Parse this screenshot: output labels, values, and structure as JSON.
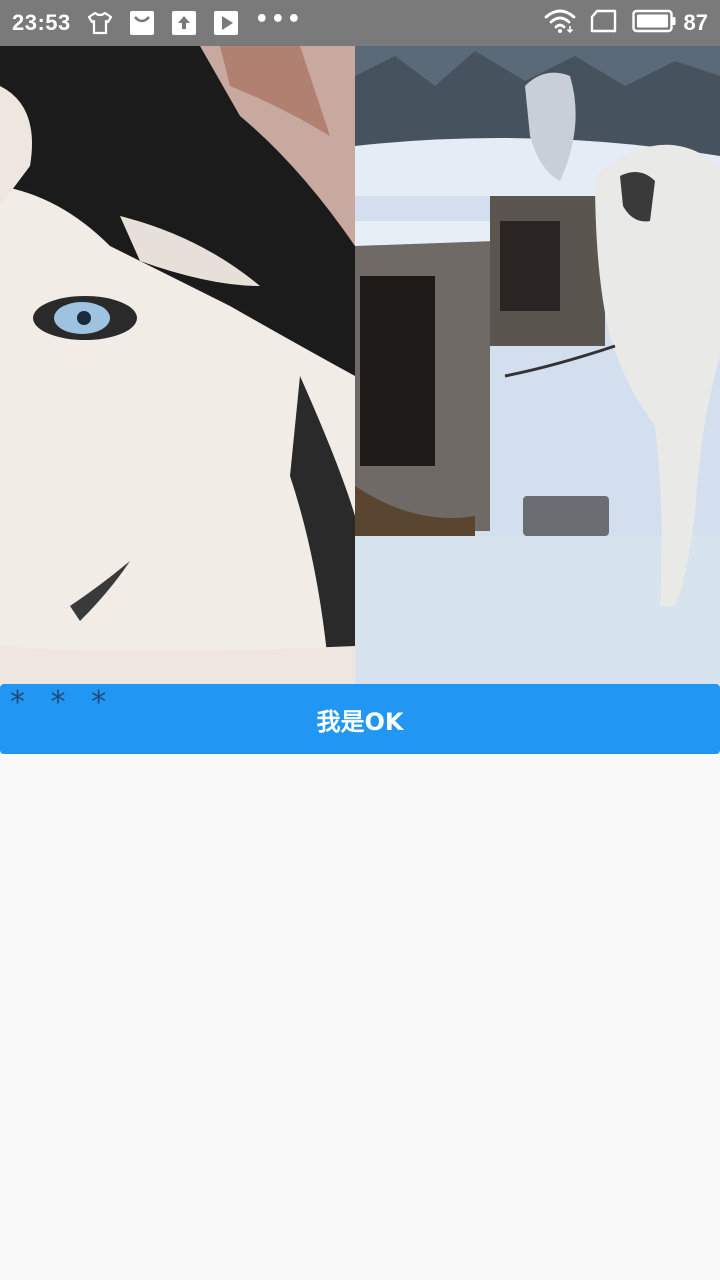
{
  "status_bar": {
    "time": "23:53",
    "left_icons": [
      "tshirt-icon",
      "shopping-bag-icon",
      "upload-icon",
      "play-icon"
    ],
    "more_dots": "•••",
    "battery_level": "87",
    "background_color": "#7a7a7a"
  },
  "images": {
    "left": "husky-closeup-photo",
    "right": "husky-snow-photo"
  },
  "button": {
    "label": "我是OK",
    "stars": "* * *",
    "color": "#2196f3"
  }
}
